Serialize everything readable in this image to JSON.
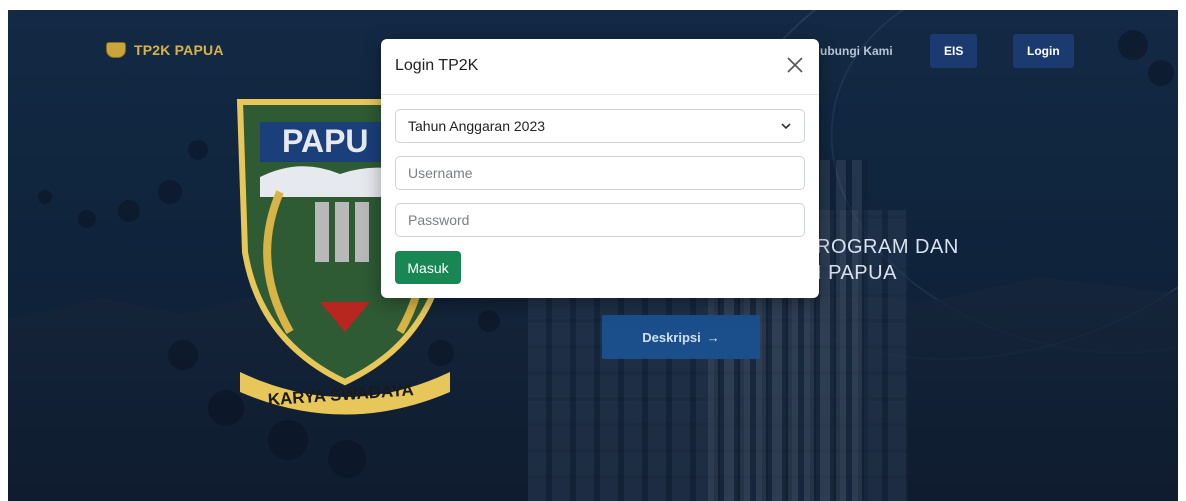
{
  "nav": {
    "brand": "TP2K PAPUA",
    "contact_partial": "ubungi Kami",
    "eis_label": "EIS",
    "login_label": "Login"
  },
  "emblem": {
    "top_text": "PAPU",
    "motto": "KARYA SWADAYA"
  },
  "hero": {
    "title_line1": "ROGRAM DAN",
    "title_line2": "I PAPUA",
    "button_label": "Deskripsi",
    "button_arrow": "→"
  },
  "modal": {
    "title": "Login TP2K",
    "close_icon": "close-icon",
    "year_select_value": "Tahun Anggaran 2023",
    "username_placeholder": "Username",
    "password_placeholder": "Password",
    "submit_label": "Masuk"
  },
  "colors": {
    "brand_gold": "#d8b446",
    "nav_button_bg": "#1a3a70",
    "submit_green": "#198754",
    "hero_button_bg": "#1a4f8c"
  }
}
